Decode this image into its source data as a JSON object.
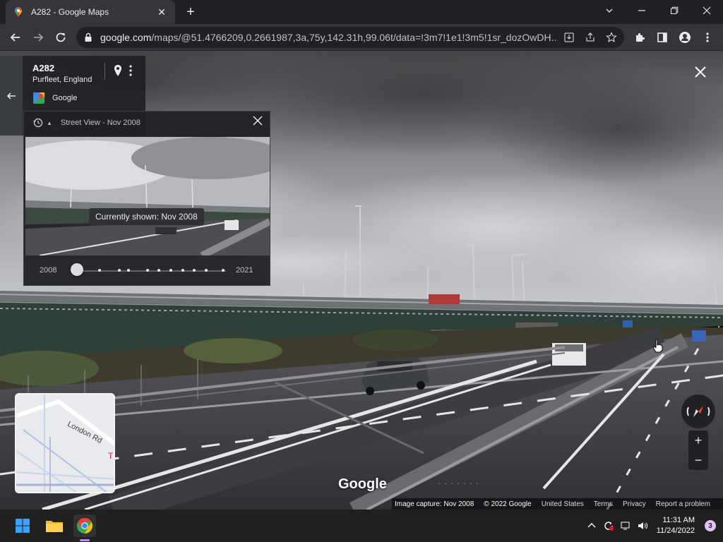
{
  "browser": {
    "tab_title": "A282 - Google Maps",
    "url_host": "google.com",
    "url_path": "/maps/@51.4766209,0.2661987,3a,75y,142.31h,99.06t/data=!3m7!1e1!3m5!1sr_dozOwDH..."
  },
  "place_card": {
    "title": "A282",
    "subtitle": "Purfleet, England",
    "source": "Google"
  },
  "timeline": {
    "header": "Street View - Nov 2008",
    "tooltip": "Currently shown: Nov 2008",
    "start_year": "2008",
    "end_year": "2021",
    "position_fraction": 0.0
  },
  "minimap": {
    "road_label": "London Rd",
    "edge_label": "T"
  },
  "branding": {
    "logo": "Google"
  },
  "attribution": {
    "capture": "Image capture: Nov 2008",
    "copyright": "© 2022 Google",
    "region": "United States",
    "terms": "Terms",
    "privacy": "Privacy",
    "report": "Report a problem"
  },
  "zoom": {
    "in": "+",
    "out": "−"
  },
  "taskbar": {
    "time": "11:31 AM",
    "date": "11/24/2022",
    "notifications": "3"
  },
  "icons": {
    "tab_favicon": "google-maps-pin-icon",
    "back": "arrow-left-icon",
    "forward": "arrow-right-icon",
    "reload": "reload-icon",
    "lock": "lock-icon",
    "download": "download-icon",
    "share": "share-icon",
    "bookmark": "star-icon",
    "extensions": "puzzle-icon",
    "sidepanel": "side-panel-icon",
    "profile": "profile-icon",
    "menu": "kebab-menu-icon"
  },
  "colors": {
    "chrome_dark": "#202124",
    "chrome_toolbar": "#35363a",
    "maps_red": "#ea4335",
    "taskbar": "#202020"
  }
}
